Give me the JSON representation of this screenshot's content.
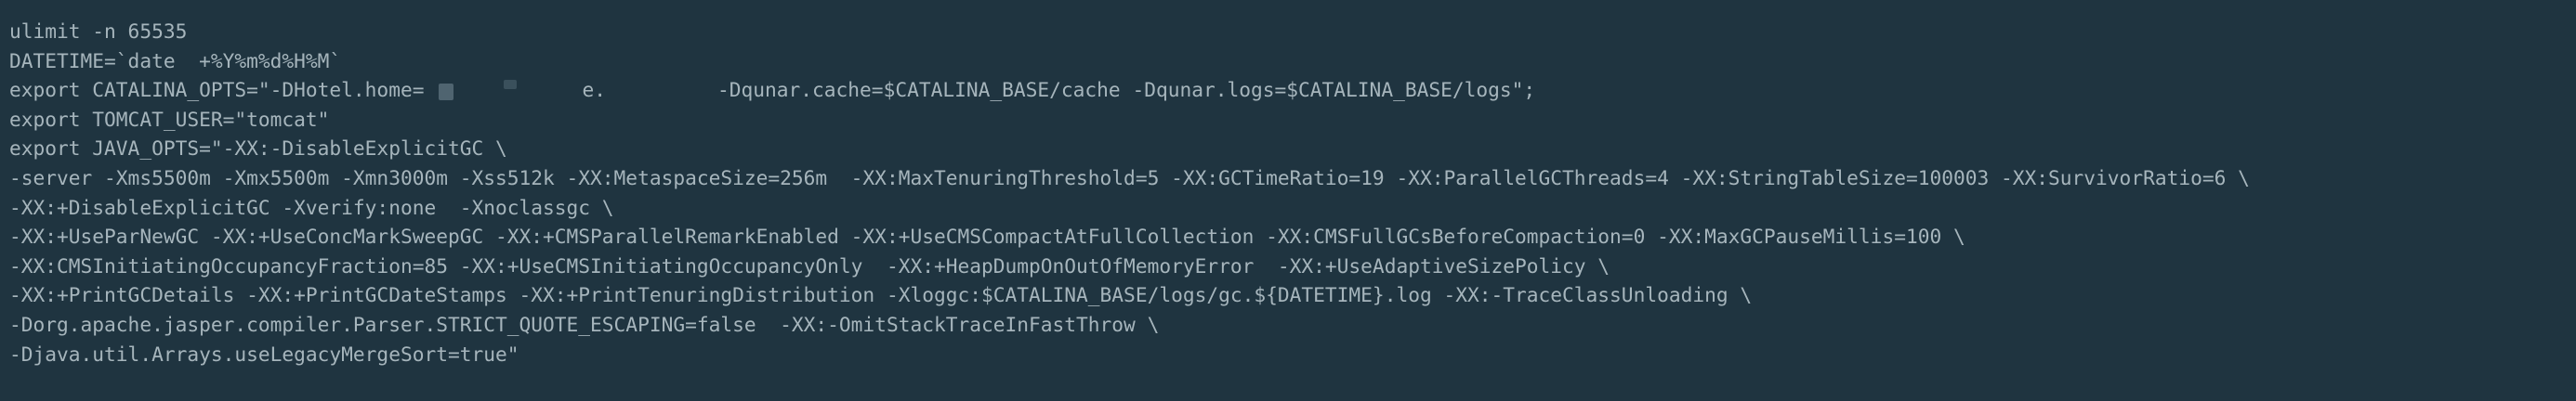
{
  "colors": {
    "background": "#1f3440",
    "text": "#a6b5bc"
  },
  "terminal": {
    "line_1": "ulimit -n 65535",
    "line_2": "DATETIME=`date  +%Y%m%d%H%M`",
    "line_3_start": "export CATALINA_OPTS=\"-DHotel.home=",
    "line_3_mid": "e.",
    "line_3_end": "-Dqunar.cache=$CATALINA_BASE/cache -Dqunar.logs=$CATALINA_BASE/logs\";",
    "line_4": "export TOMCAT_USER=\"tomcat\"",
    "line_5": "export JAVA_OPTS=\"-XX:-DisableExplicitGC \\",
    "line_6": "-server -Xms5500m -Xmx5500m -Xmn3000m -Xss512k -XX:MetaspaceSize=256m  -XX:MaxTenuringThreshold=5 -XX:GCTimeRatio=19 -XX:ParallelGCThreads=4 -XX:StringTableSize=100003 -XX:SurvivorRatio=6 \\",
    "line_7": "-XX:+DisableExplicitGC -Xverify:none  -Xnoclassgc \\",
    "line_8": "-XX:+UseParNewGC -XX:+UseConcMarkSweepGC -XX:+CMSParallelRemarkEnabled -XX:+UseCMSCompactAtFullCollection -XX:CMSFullGCsBeforeCompaction=0 -XX:MaxGCPauseMillis=100 \\",
    "line_9": "-XX:CMSInitiatingOccupancyFraction=85 -XX:+UseCMSInitiatingOccupancyOnly  -XX:+HeapDumpOnOutOfMemoryError  -XX:+UseAdaptiveSizePolicy \\",
    "line_10": "-XX:+PrintGCDetails -XX:+PrintGCDateStamps -XX:+PrintTenuringDistribution -Xloggc:$CATALINA_BASE/logs/gc.${DATETIME}.log -XX:-TraceClassUnloading \\",
    "line_11": "-Dorg.apache.jasper.compiler.Parser.STRICT_QUOTE_ESCAPING=false  -XX:-OmitStackTraceInFastThrow \\",
    "line_12": "-Djava.util.Arrays.useLegacyMergeSort=true\""
  }
}
